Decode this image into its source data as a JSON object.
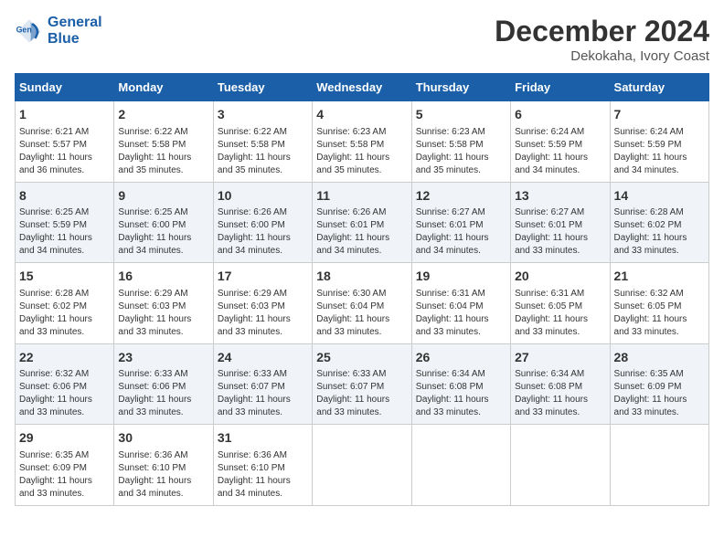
{
  "header": {
    "logo_line1": "General",
    "logo_line2": "Blue",
    "title": "December 2024",
    "subtitle": "Dekokaha, Ivory Coast"
  },
  "days_of_week": [
    "Sunday",
    "Monday",
    "Tuesday",
    "Wednesday",
    "Thursday",
    "Friday",
    "Saturday"
  ],
  "weeks": [
    [
      {
        "day": "1",
        "text": "Sunrise: 6:21 AM\nSunset: 5:57 PM\nDaylight: 11 hours\nand 36 minutes."
      },
      {
        "day": "2",
        "text": "Sunrise: 6:22 AM\nSunset: 5:58 PM\nDaylight: 11 hours\nand 35 minutes."
      },
      {
        "day": "3",
        "text": "Sunrise: 6:22 AM\nSunset: 5:58 PM\nDaylight: 11 hours\nand 35 minutes."
      },
      {
        "day": "4",
        "text": "Sunrise: 6:23 AM\nSunset: 5:58 PM\nDaylight: 11 hours\nand 35 minutes."
      },
      {
        "day": "5",
        "text": "Sunrise: 6:23 AM\nSunset: 5:58 PM\nDaylight: 11 hours\nand 35 minutes."
      },
      {
        "day": "6",
        "text": "Sunrise: 6:24 AM\nSunset: 5:59 PM\nDaylight: 11 hours\nand 34 minutes."
      },
      {
        "day": "7",
        "text": "Sunrise: 6:24 AM\nSunset: 5:59 PM\nDaylight: 11 hours\nand 34 minutes."
      }
    ],
    [
      {
        "day": "8",
        "text": "Sunrise: 6:25 AM\nSunset: 5:59 PM\nDaylight: 11 hours\nand 34 minutes."
      },
      {
        "day": "9",
        "text": "Sunrise: 6:25 AM\nSunset: 6:00 PM\nDaylight: 11 hours\nand 34 minutes."
      },
      {
        "day": "10",
        "text": "Sunrise: 6:26 AM\nSunset: 6:00 PM\nDaylight: 11 hours\nand 34 minutes."
      },
      {
        "day": "11",
        "text": "Sunrise: 6:26 AM\nSunset: 6:01 PM\nDaylight: 11 hours\nand 34 minutes."
      },
      {
        "day": "12",
        "text": "Sunrise: 6:27 AM\nSunset: 6:01 PM\nDaylight: 11 hours\nand 34 minutes."
      },
      {
        "day": "13",
        "text": "Sunrise: 6:27 AM\nSunset: 6:01 PM\nDaylight: 11 hours\nand 33 minutes."
      },
      {
        "day": "14",
        "text": "Sunrise: 6:28 AM\nSunset: 6:02 PM\nDaylight: 11 hours\nand 33 minutes."
      }
    ],
    [
      {
        "day": "15",
        "text": "Sunrise: 6:28 AM\nSunset: 6:02 PM\nDaylight: 11 hours\nand 33 minutes."
      },
      {
        "day": "16",
        "text": "Sunrise: 6:29 AM\nSunset: 6:03 PM\nDaylight: 11 hours\nand 33 minutes."
      },
      {
        "day": "17",
        "text": "Sunrise: 6:29 AM\nSunset: 6:03 PM\nDaylight: 11 hours\nand 33 minutes."
      },
      {
        "day": "18",
        "text": "Sunrise: 6:30 AM\nSunset: 6:04 PM\nDaylight: 11 hours\nand 33 minutes."
      },
      {
        "day": "19",
        "text": "Sunrise: 6:31 AM\nSunset: 6:04 PM\nDaylight: 11 hours\nand 33 minutes."
      },
      {
        "day": "20",
        "text": "Sunrise: 6:31 AM\nSunset: 6:05 PM\nDaylight: 11 hours\nand 33 minutes."
      },
      {
        "day": "21",
        "text": "Sunrise: 6:32 AM\nSunset: 6:05 PM\nDaylight: 11 hours\nand 33 minutes."
      }
    ],
    [
      {
        "day": "22",
        "text": "Sunrise: 6:32 AM\nSunset: 6:06 PM\nDaylight: 11 hours\nand 33 minutes."
      },
      {
        "day": "23",
        "text": "Sunrise: 6:33 AM\nSunset: 6:06 PM\nDaylight: 11 hours\nand 33 minutes."
      },
      {
        "day": "24",
        "text": "Sunrise: 6:33 AM\nSunset: 6:07 PM\nDaylight: 11 hours\nand 33 minutes."
      },
      {
        "day": "25",
        "text": "Sunrise: 6:33 AM\nSunset: 6:07 PM\nDaylight: 11 hours\nand 33 minutes."
      },
      {
        "day": "26",
        "text": "Sunrise: 6:34 AM\nSunset: 6:08 PM\nDaylight: 11 hours\nand 33 minutes."
      },
      {
        "day": "27",
        "text": "Sunrise: 6:34 AM\nSunset: 6:08 PM\nDaylight: 11 hours\nand 33 minutes."
      },
      {
        "day": "28",
        "text": "Sunrise: 6:35 AM\nSunset: 6:09 PM\nDaylight: 11 hours\nand 33 minutes."
      }
    ],
    [
      {
        "day": "29",
        "text": "Sunrise: 6:35 AM\nSunset: 6:09 PM\nDaylight: 11 hours\nand 33 minutes."
      },
      {
        "day": "30",
        "text": "Sunrise: 6:36 AM\nSunset: 6:10 PM\nDaylight: 11 hours\nand 34 minutes."
      },
      {
        "day": "31",
        "text": "Sunrise: 6:36 AM\nSunset: 6:10 PM\nDaylight: 11 hours\nand 34 minutes."
      },
      {
        "day": "",
        "text": ""
      },
      {
        "day": "",
        "text": ""
      },
      {
        "day": "",
        "text": ""
      },
      {
        "day": "",
        "text": ""
      }
    ]
  ]
}
